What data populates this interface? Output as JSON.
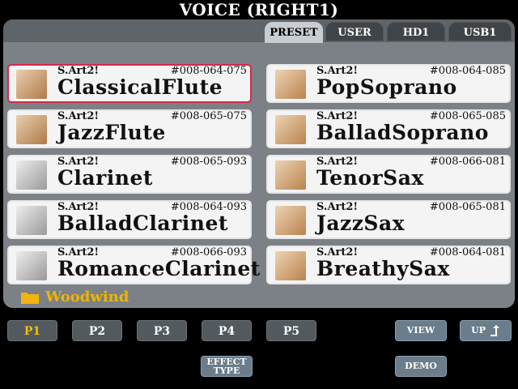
{
  "header": {
    "title": "VOICE (RIGHT1)"
  },
  "tabs": [
    {
      "label": "PRESET",
      "active": true
    },
    {
      "label": "USER",
      "active": false
    },
    {
      "label": "HD1",
      "active": false
    },
    {
      "label": "USB1",
      "active": false
    }
  ],
  "voices": [
    {
      "tag": "S.Art2!",
      "number": "#008-064-075",
      "name": "ClassicalFlute",
      "icon": "flute-icon",
      "selected": true
    },
    {
      "tag": "S.Art2!",
      "number": "#008-064-085",
      "name": "PopSoprano",
      "icon": "saxophone-icon"
    },
    {
      "tag": "S.Art2!",
      "number": "#008-065-075",
      "name": "JazzFlute",
      "icon": "flute-icon"
    },
    {
      "tag": "S.Art2!",
      "number": "#008-065-085",
      "name": "BalladSoprano",
      "icon": "saxophone-icon"
    },
    {
      "tag": "S.Art2!",
      "number": "#008-065-093",
      "name": "Clarinet",
      "icon": "clarinet-icon"
    },
    {
      "tag": "S.Art2!",
      "number": "#008-066-081",
      "name": "TenorSax",
      "icon": "saxophone-icon"
    },
    {
      "tag": "S.Art2!",
      "number": "#008-064-093",
      "name": "BalladClarinet",
      "icon": "clarinet-icon"
    },
    {
      "tag": "S.Art2!",
      "number": "#008-065-081",
      "name": "JazzSax",
      "icon": "saxophone-icon"
    },
    {
      "tag": "S.Art2!",
      "number": "#008-066-093",
      "name": "RomanceClarinet",
      "icon": "clarinet-icon"
    },
    {
      "tag": "S.Art2!",
      "number": "#008-064-081",
      "name": "BreathySax",
      "icon": "saxophone-icon"
    }
  ],
  "folder": {
    "label": "Woodwind",
    "icon": "folder-icon"
  },
  "pages": [
    {
      "label": "P1",
      "active": true
    },
    {
      "label": "P2"
    },
    {
      "label": "P3"
    },
    {
      "label": "P4"
    },
    {
      "label": "P5"
    }
  ],
  "buttons": {
    "view": "VIEW",
    "up": "UP",
    "effect_type_1": "EFFECT",
    "effect_type_2": "TYPE",
    "demo": "DEMO"
  },
  "colors": {
    "selected_border": "#d8284a",
    "folder_label": "#f0b400",
    "active_page": "#f0c000"
  }
}
